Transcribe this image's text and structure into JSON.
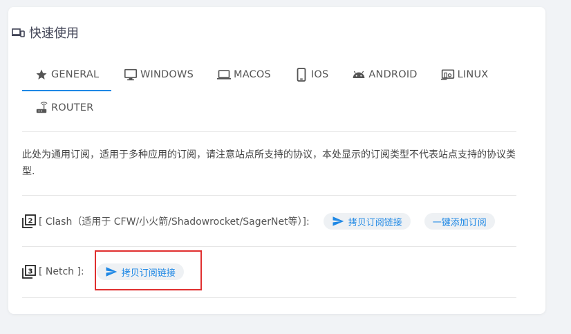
{
  "card": {
    "title": "快速使用",
    "title_icon": "devices-icon"
  },
  "tabs": [
    {
      "label": "GENERAL",
      "icon": "star-icon",
      "active": true
    },
    {
      "label": "WINDOWS",
      "icon": "monitor-icon",
      "active": false
    },
    {
      "label": "MACOS",
      "icon": "laptop-icon",
      "active": false
    },
    {
      "label": "IOS",
      "icon": "phone-icon",
      "active": false
    },
    {
      "label": "ANDROID",
      "icon": "android-icon",
      "active": false
    },
    {
      "label": "LINUX",
      "icon": "linux-devices-icon",
      "active": false
    },
    {
      "label": "ROUTER",
      "icon": "router-icon",
      "active": false
    }
  ],
  "description": "此处为通用订阅，适用于多种应用的订阅，请注意站点所支持的协议，本处显示的订阅类型不代表站点支持的协议类型.",
  "subscriptions": [
    {
      "label": "[ Clash（适用于 CFW/小火箭/Shadowrocket/SagerNet等）]:",
      "copy_button": "拷贝订阅链接",
      "import_button": "一键添加订阅"
    },
    {
      "label": "[ Netch ]:",
      "copy_button": "拷贝订阅链接"
    }
  ],
  "colors": {
    "accent": "#1e88e5",
    "highlight_border": "#e02f2f",
    "chip_bg": "#eef1f4"
  }
}
